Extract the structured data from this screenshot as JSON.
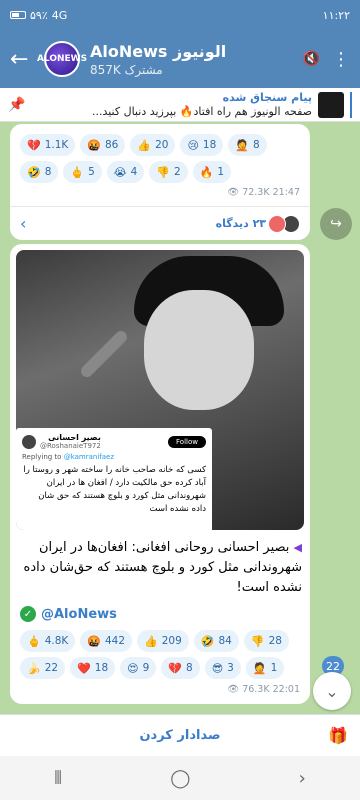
{
  "status": {
    "time": "۱۱:۲۲",
    "battery": "۵۹٪",
    "net": "4G"
  },
  "header": {
    "title": "AloNews الونیوز",
    "subscribers": "857K مشترک",
    "avatar_text": "ALONEWS"
  },
  "pinned": {
    "title": "پیام سنجاق شده",
    "body": "صفحه الونیوز هم راه افتاد🔥 بپرزید دنبال کنید..."
  },
  "bubble1": {
    "reactions": [
      {
        "emoji": "💔",
        "count": "1.1K"
      },
      {
        "emoji": "🤬",
        "count": "86"
      },
      {
        "emoji": "👍",
        "count": "20"
      },
      {
        "emoji": "😢",
        "count": "18"
      },
      {
        "emoji": "🤦",
        "count": "8"
      },
      {
        "emoji": "🤣",
        "count": "8"
      },
      {
        "emoji": "🖕",
        "count": "5"
      },
      {
        "emoji": "😭",
        "count": "4"
      },
      {
        "emoji": "👎",
        "count": "2"
      },
      {
        "emoji": "🔥",
        "count": "1"
      }
    ],
    "views": "72.3K",
    "time": "21:47",
    "comments": "۲۳ دیدگاه"
  },
  "post": {
    "tweet": {
      "name": "بصیر احسانی",
      "handle": "@RoshanaieT972",
      "follow": "Follow",
      "replying_label": "Replying to",
      "replying_to": "@kamranifaez",
      "text": "کسی که خانه صاحب خانه را ساخته شهر و روستا را آباد کرده حق مالکیت دارد / افغان ها در ایران شهروندانی مثل کورد و بلوچ هستند که حق شان داده نشده است"
    },
    "caption": "بصیر احسانی روحانی افغانی: افغان‌ها در ایران شهروندانی مثل کورد و بلوچ هستند که حق‌شان داده نشده است!",
    "handle": "@AloNews",
    "reactions": [
      {
        "emoji": "🖕",
        "count": "4.8K"
      },
      {
        "emoji": "🤬",
        "count": "442"
      },
      {
        "emoji": "👍",
        "count": "209"
      },
      {
        "emoji": "🤣",
        "count": "84"
      },
      {
        "emoji": "👎",
        "count": "28"
      },
      {
        "emoji": "🍌",
        "count": "22"
      },
      {
        "emoji": "❤️",
        "count": "18"
      },
      {
        "emoji": "😍",
        "count": "9"
      },
      {
        "emoji": "💔",
        "count": "8"
      },
      {
        "emoji": "😎",
        "count": "3"
      },
      {
        "emoji": "🤦",
        "count": "1"
      }
    ],
    "views": "76.3K",
    "time": "22:01"
  },
  "unread_count": "22",
  "bottom": {
    "mute_label": "صدادار کردن"
  }
}
